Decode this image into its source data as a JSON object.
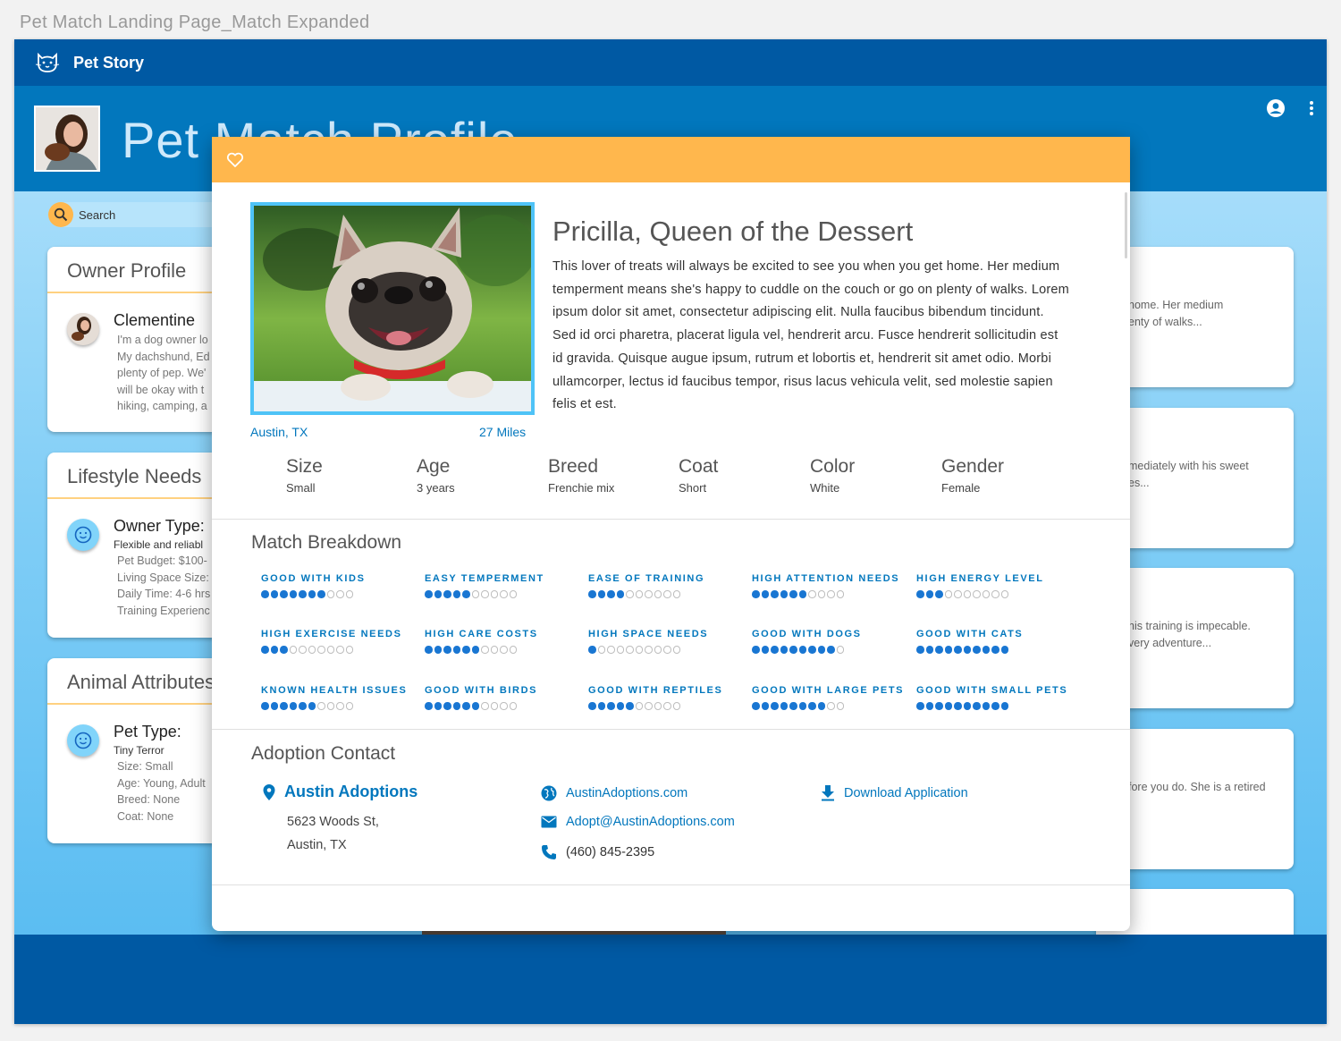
{
  "frame_title": "Pet Match Landing Page_Match Expanded",
  "app": {
    "brand_name": "Pet Story",
    "page_title": "Pet Match Profile",
    "search_placeholder": "Search"
  },
  "owner_profile": {
    "title": "Owner Profile",
    "name": "Clementine",
    "bio_lines": [
      "I'm a dog owner lo",
      "My dachshund, Ed",
      "plenty of pep. We'",
      "will be okay with t",
      "hiking, camping, a"
    ]
  },
  "lifestyle_needs": {
    "title": "Lifestyle Needs",
    "heading": "Owner Type:",
    "subheading": "Flexible and reliabl",
    "lines": [
      "Pet Budget: $100-",
      "Living Space Size:",
      "Daily Time: 4-6 hrs",
      "Training Experienc"
    ]
  },
  "animal_attributes": {
    "title": "Animal Attributes",
    "heading": "Pet Type:",
    "subheading": "Tiny Terror",
    "lines": [
      "Size: Small",
      "Age: Young, Adult",
      "Breed: None",
      "Coat: None"
    ]
  },
  "background_cards": [
    {
      "lines": [
        "home. Her medium",
        "enty of walks..."
      ]
    },
    {
      "lines": [
        "mediately with his sweet",
        "es..."
      ]
    },
    {
      "lines": [
        "his training is impecable.",
        "very adventure..."
      ]
    },
    {
      "lines": [
        "fore you do. She is a retired"
      ]
    },
    {
      "lines": []
    }
  ],
  "modal": {
    "pet_name": "Pricilla, Queen of the Dessert",
    "description": "This lover of treats will always be excited to see you when you get home. Her medium temperment means she's happy to cuddle on the couch or go on plenty of walks. Lorem ipsum dolor sit amet, consectetur adipiscing elit. Nulla faucibus bibendum tincidunt. Sed id orci pharetra, placerat ligula vel, hendrerit arcu. Fusce hendrerit sollicitudin est id gravida. Quisque augue ipsum, rutrum et lobortis et, hendrerit sit amet odio. Morbi ullamcorper, lectus id faucibus tempor, risus lacus vehicula velit, sed molestie sapien felis et est.",
    "location": "Austin, TX",
    "distance": "27 Miles",
    "attributes": [
      {
        "label": "Size",
        "value": "Small"
      },
      {
        "label": "Age",
        "value": "3 years"
      },
      {
        "label": "Breed",
        "value": "Frenchie mix"
      },
      {
        "label": "Coat",
        "value": "Short"
      },
      {
        "label": "Color",
        "value": "White"
      },
      {
        "label": "Gender",
        "value": "Female"
      }
    ],
    "match_title": "Match Breakdown",
    "match_scale_max": 10,
    "match": [
      {
        "label": "GOOD WITH KIDS",
        "score": 7
      },
      {
        "label": "EASY TEMPERMENT",
        "score": 5
      },
      {
        "label": "EASE OF TRAINING",
        "score": 4
      },
      {
        "label": "HIGH ATTENTION NEEDS",
        "score": 6
      },
      {
        "label": "HIGH ENERGY LEVEL",
        "score": 3
      },
      {
        "label": "HIGH EXERCISE NEEDS",
        "score": 3
      },
      {
        "label": "HIGH CARE COSTS",
        "score": 6
      },
      {
        "label": "HIGH SPACE NEEDS",
        "score": 1
      },
      {
        "label": "GOOD WITH DOGS",
        "score": 9
      },
      {
        "label": "GOOD WITH CATS",
        "score": 10
      },
      {
        "label": "KNOWN HEALTH ISSUES",
        "score": 6
      },
      {
        "label": "GOOD WITH BIRDS",
        "score": 6
      },
      {
        "label": "GOOD WITH REPTILES",
        "score": 5
      },
      {
        "label": "GOOD WITH LARGE PETS",
        "score": 8
      },
      {
        "label": "GOOD WITH SMALL PETS",
        "score": 10
      }
    ],
    "contact": {
      "title": "Adoption Contact",
      "org_name": "Austin Adoptions",
      "address_line1": "5623 Woods St,",
      "address_line2": "Austin, TX",
      "website": "AustinAdoptions.com",
      "email": "Adopt@AustinAdoptions.com",
      "phone": "(460) 845-2395",
      "download_label": "Download Application"
    }
  },
  "colors": {
    "primary_dark": "#0059a3",
    "primary": "#0277bd",
    "accent": "#ffb74d",
    "dot_active": "#1976d2",
    "photo_border": "#4fc3f7"
  }
}
